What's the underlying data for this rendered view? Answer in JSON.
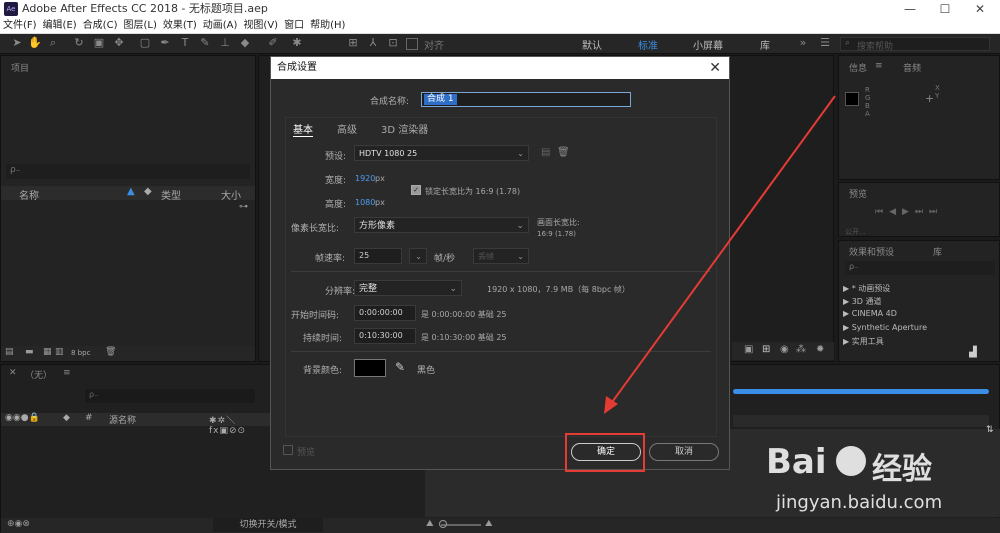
{
  "app": {
    "icon": "Ae",
    "title": "Adobe After Effects CC 2018 - 无标题项目.aep",
    "min": "—",
    "max": "☐",
    "close": "✕"
  },
  "menu": [
    "文件(F)",
    "编辑(E)",
    "合成(C)",
    "图层(L)",
    "效果(T)",
    "动画(A)",
    "视图(V)",
    "窗口",
    "帮助(H)"
  ],
  "toolbar": {
    "align_label": "对齐",
    "workspaces": [
      "默认",
      "标准",
      "小屏幕",
      "库"
    ],
    "active_workspace": "标准",
    "search_placeholder": "搜索帮助"
  },
  "project": {
    "title": "项目",
    "search_placeholder": "ρ₋",
    "col_name": "名称",
    "col_type": "类型",
    "col_size": "大小",
    "bpc": "8 bpc"
  },
  "timeline": {
    "tab_label": "（无）",
    "col_source": "源名称",
    "footer_toggle": "切换开关/模式"
  },
  "info": {
    "tab_info": "信息",
    "tab_audio": "音频",
    "rgb": [
      "R",
      "G",
      "B",
      "A"
    ],
    "xy": [
      "X",
      "Y"
    ]
  },
  "preview": {
    "title": "预览",
    "clip": "公开..."
  },
  "effects": {
    "title": "效果和预设",
    "tab_lib": "库",
    "search_placeholder": "ρ₋",
    "items": [
      "* 动画预设",
      "3D 通道",
      "CINEMA 4D",
      "Synthetic Aperture",
      "实用工具"
    ]
  },
  "dialog": {
    "title": "合成设置",
    "name_label": "合成名称:",
    "name_value": "合成 1",
    "tabs": [
      "基本",
      "高级",
      "3D 渲染器"
    ],
    "preset_label": "预设:",
    "preset_value": "HDTV 1080 25",
    "width_label": "宽度:",
    "width_value": "1920",
    "width_unit": "px",
    "height_label": "高度:",
    "height_value": "1080",
    "height_unit": "px",
    "lock_label": "锁定长宽比为 16:9 (1.78)",
    "par_label": "像素长宽比:",
    "par_value": "方形像素",
    "frame_aspect_label": "画面长宽比:",
    "frame_aspect_value": "16:9 (1.78)",
    "fps_label": "帧速率:",
    "fps_value": "25",
    "fps_unit": "帧/秒",
    "dropframe": "丢帧",
    "res_label": "分辨率:",
    "res_value": "完整",
    "res_info": "1920 x 1080，7.9 MB（每 8bpc 帧）",
    "start_label": "开始时间码:",
    "start_value": "0:00:00:00",
    "start_info": "是 0:00:00:00  基础 25",
    "dur_label": "持续时间:",
    "dur_value": "0:10:30:00",
    "dur_info": "是 0:10:30:00  基础 25",
    "bg_label": "背景颜色:",
    "bg_color": "#000000",
    "bg_name": "黑色",
    "preview_label": "预览",
    "ok": "确定",
    "cancel": "取消"
  },
  "watermark": {
    "brand": "Bai",
    "brand2": "经验",
    "url": "jingyan.baidu.com"
  },
  "colors": {
    "accent": "#3a8ee6",
    "annotation": "#e43b35"
  }
}
